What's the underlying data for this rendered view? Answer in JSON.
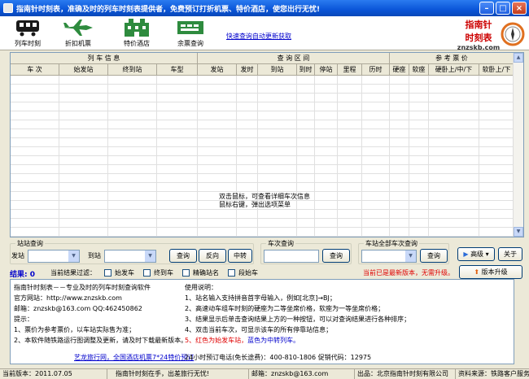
{
  "window": {
    "title": "指南针时刻表，准确及时的列车时刻表提供者，免费预订打折机票、特价酒店，使您出行无忧!"
  },
  "toolbar": {
    "items": [
      {
        "label": "列车时刻",
        "icon": "train-icon"
      },
      {
        "label": "折扣机票",
        "icon": "plane-icon"
      },
      {
        "label": "特价酒店",
        "icon": "hotel-icon"
      },
      {
        "label": "余票查询",
        "icon": "ticket-icon"
      }
    ],
    "home_link": "快速查询自动更新获取"
  },
  "logo": {
    "line1": "指南针",
    "line2": "时刻表",
    "site": "znzskb.com"
  },
  "grid": {
    "groups": [
      "列  车  信  息",
      "查  询  区  间",
      "参  考  票  价"
    ],
    "columns": [
      "车  次",
      "始发站",
      "终到站",
      "车型",
      "发站",
      "发时",
      "到站",
      "到时",
      "停站",
      "里程",
      "历时",
      "硬座",
      "软座",
      "硬卧上/中/下",
      "软卧上/下"
    ],
    "hint_line1": "双击鼠标，可查看详细车次信息",
    "hint_line2": "鼠标右键，弹出选项菜单"
  },
  "query": {
    "station_legend": "站站查询",
    "from_label": "发站",
    "to_label": "到站",
    "query_button": "查询",
    "reverse_button": "反向",
    "transfer_button": "中转",
    "train_legend": "车次查询",
    "train_query_button": "查询",
    "station_all_legend": "车站全部车次查询",
    "station_query_button": "查询",
    "advanced_button": "高级",
    "about_button": "关于"
  },
  "result": {
    "label": "结果: 0",
    "filter_label": "当前结果过滤：",
    "filters": [
      "始发车",
      "终到车",
      "精确站名",
      "段始车"
    ],
    "version_notice": "当前已是最新版本，无需升级。",
    "upgrade_button": "版本升级"
  },
  "info": {
    "left_lines": [
      "指南针时刻表－－专业及时的列车时刻查询软件",
      "官方网站：http://www.znzskb.com",
      "邮箱：znzskb@163.com QQ:462450862",
      "提示：",
      "1、票价为参考票价，以车站实际售为准；",
      "2、本软件随铁路运行图调整及更新，请及时下载最新版本。"
    ],
    "right_title": "使用说明：",
    "right_lines": [
      "1、站名输入支持拼音首字母输入，例如[北京]→BJ；",
      "2、高速动车组车时刻的硬座为二等坐席价格，软座为一等坐席价格；",
      "3、结果显示后单击查询结果上方的一种按钮，可以对查询结果进行各种排序；",
      "4、双击当前车次，可显示该车的所有停靠站信息；"
    ],
    "line5_red": "5、红色为始发车站，",
    "line5_blue": "蓝色为中转列车。",
    "promo_link": "艺龙旅行网，全国酒店机票7*24特价预订",
    "phone": "24小时预订电话(免长途费)：400-810-1806 促销代码：12975"
  },
  "statusbar": {
    "version": "当前版本：2011.07.05",
    "slogan": "指南针时刻在手，出差旅行无忧!",
    "email": "邮箱：znzskb@163.com",
    "producer": "出品：北京指南针时刻有限公司",
    "support": "资料来源：铁路客户服务中心"
  },
  "colors": {
    "title_bar": "#0a55d8",
    "accent_red": "#e00000",
    "link_blue": "#0000cc"
  }
}
